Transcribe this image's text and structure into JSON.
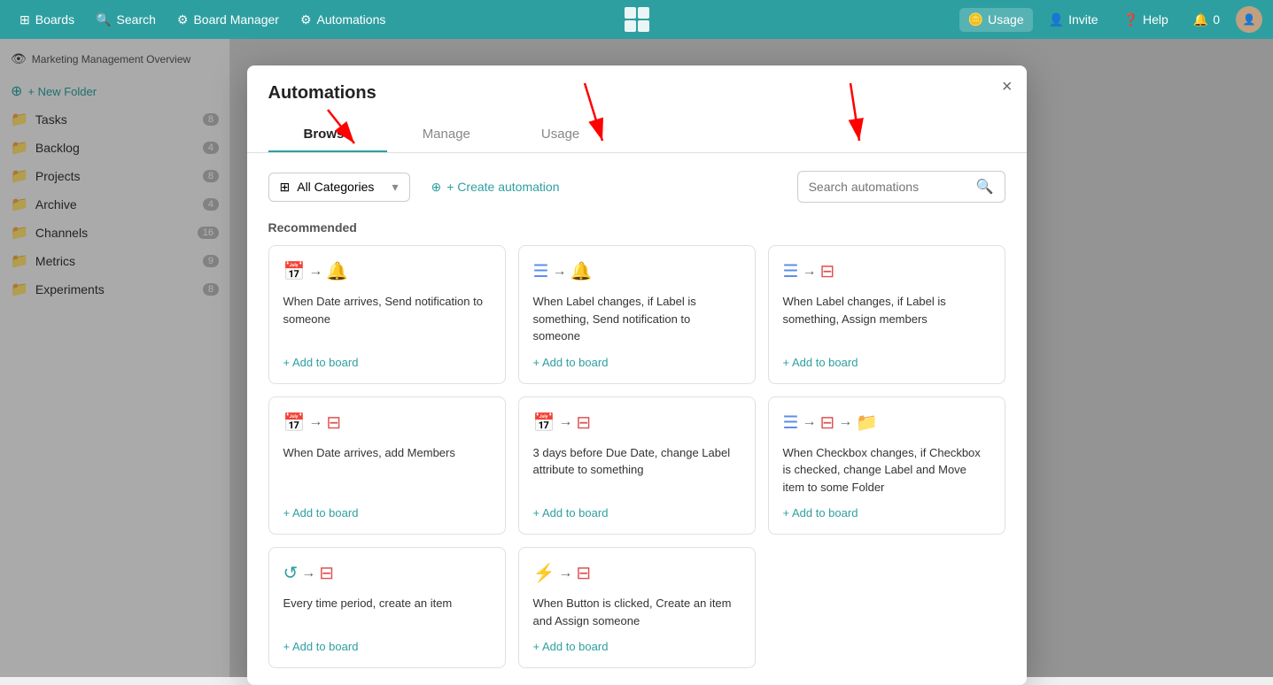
{
  "topNav": {
    "boards": "Boards",
    "search": "Search",
    "boardManager": "Board Manager",
    "automations": "Automations",
    "usage": "Usage",
    "invite": "Invite",
    "help": "Help",
    "notifications": "0"
  },
  "sidebar": {
    "boardTitle": "Marketing Management Overview",
    "newFolder": "+ New Folder",
    "items": [
      {
        "label": "Tasks",
        "count": "8"
      },
      {
        "label": "Backlog",
        "count": "4"
      },
      {
        "label": "Projects",
        "count": "8"
      },
      {
        "label": "Archive",
        "count": "4"
      },
      {
        "label": "Channels",
        "count": "16"
      },
      {
        "label": "Metrics",
        "count": "9"
      },
      {
        "label": "Experiments",
        "count": "8"
      }
    ]
  },
  "modal": {
    "title": "Automations",
    "tabs": [
      "Browse",
      "Manage",
      "Usage"
    ],
    "activeTab": 0,
    "closeBtn": "×",
    "categorySelect": "All Categories",
    "createBtn": "+ Create automation",
    "searchPlaceholder": "Search automations",
    "recommended": "Recommended",
    "cards": [
      {
        "iconA": "📅",
        "iconB": "🔔",
        "desc": "When Date arrives, Send notification to someone",
        "addLabel": "+ Add to board"
      },
      {
        "iconA": "≡",
        "iconB": "🔔",
        "desc": "When Label changes, if Label is something, Send notification to someone",
        "addLabel": "+ Add to board"
      },
      {
        "iconA": "≡",
        "iconB": "⊟",
        "desc": "When Label changes, if Label is something, Assign members",
        "addLabel": "+ Add to board"
      },
      {
        "iconA": "📅",
        "iconB": "⊟",
        "desc": "When Date arrives, add Members",
        "addLabel": "+ Add to board"
      },
      {
        "iconA": "📅",
        "iconB": "⊟",
        "desc": "3 days before Due Date, change Label attribute to something",
        "addLabel": "+ Add to board"
      },
      {
        "iconA": "☑",
        "iconB": "⊟",
        "desc": "When Checkbox changes, if Checkbox is checked, change Label and Move item to some Folder",
        "addLabel": "+ Add to board"
      },
      {
        "iconA": "↺",
        "iconB": "⊟",
        "desc": "Every time period, create an item",
        "addLabel": "+ Add to board"
      },
      {
        "iconA": "⚡",
        "iconB": "⊟",
        "desc": "When Button is clicked, Create an item and Assign someone",
        "addLabel": "+ Add to board"
      }
    ]
  }
}
